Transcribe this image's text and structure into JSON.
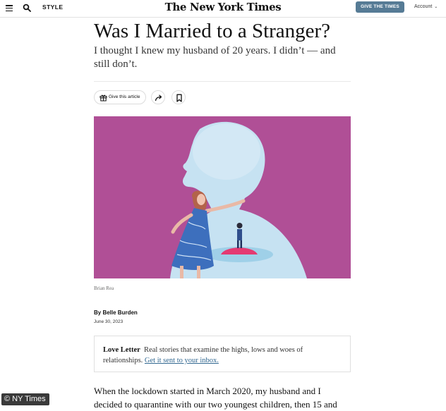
{
  "colors": {
    "accent": "#567b95",
    "link": "#326891",
    "illustration_bg": "#b04f96"
  },
  "header": {
    "menu_icon": "hamburger-menu-icon",
    "search_icon": "search-icon",
    "section": "STYLE",
    "masthead": "The New York Times",
    "give_button": "GIVE THE TIMES",
    "account": "Account",
    "account_icon": "chevron-down-icon"
  },
  "article": {
    "headline": "Was I Married to a Stranger?",
    "summary": "I thought I knew my husband of 20 years. I didn’t — and still don’t.",
    "share": {
      "give_label": "Give this article",
      "give_icon": "gift-icon",
      "share_icon": "share-arrow-icon",
      "save_icon": "bookmark-icon"
    },
    "image_credit": "Brian Rea",
    "byline_prefix": "By ",
    "author": "Belle Burden",
    "date": "June 30, 2023",
    "callout": {
      "series": "Love Letter",
      "text": "Real stories that examine the highs, lows and woes of relationships.",
      "cta": "Get it sent to your inbox."
    },
    "body_line_1": "When the lockdown started in March 2020, my husband and I",
    "body_line_2": "decided to quarantine with our two youngest children, then 15 and"
  },
  "watermark": "© NY Times"
}
